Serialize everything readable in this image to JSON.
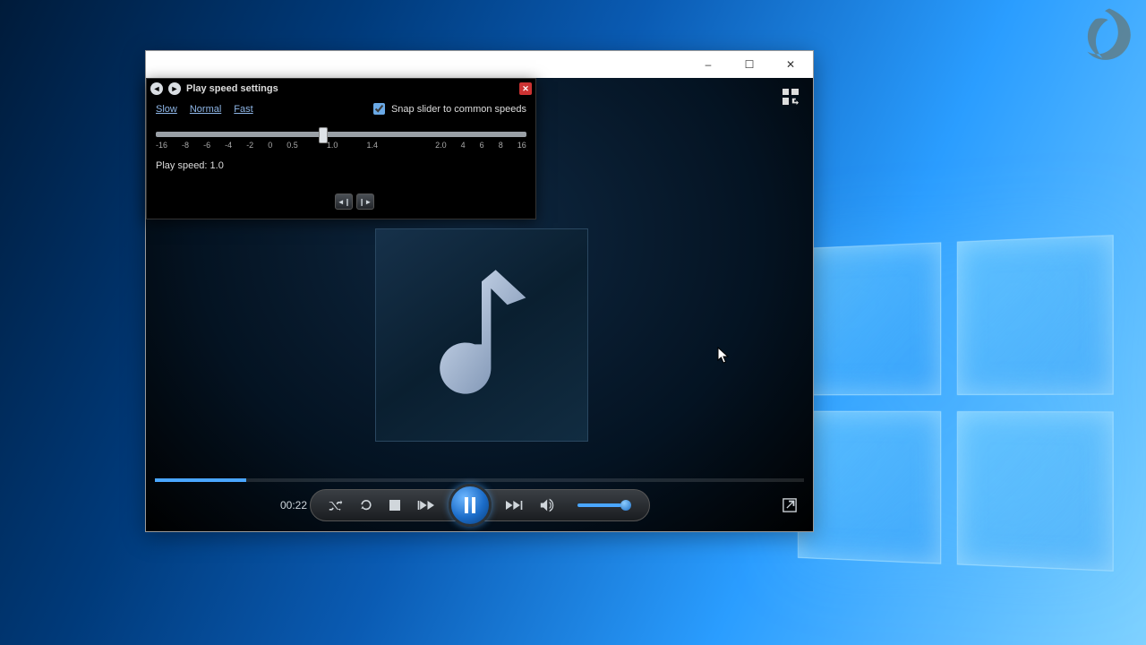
{
  "window": {
    "minimize": "–",
    "maximize": "☐",
    "close": "✕"
  },
  "popup": {
    "title": "Play speed settings",
    "links": {
      "slow": "Slow",
      "normal": "Normal",
      "fast": "Fast"
    },
    "snap_label": "Snap slider to common speeds",
    "snap_checked": true,
    "ticks": [
      "-16",
      "-8",
      "-6",
      "-4",
      "-2",
      "0",
      "0.5",
      "",
      "1.0",
      "",
      "1.4",
      "",
      "",
      "",
      "2.0",
      "4",
      "6",
      "8",
      "16"
    ],
    "speed_label": "Play speed: 1.0"
  },
  "playback": {
    "time": "00:22",
    "progress_pct": 14,
    "volume_pct": 82
  }
}
